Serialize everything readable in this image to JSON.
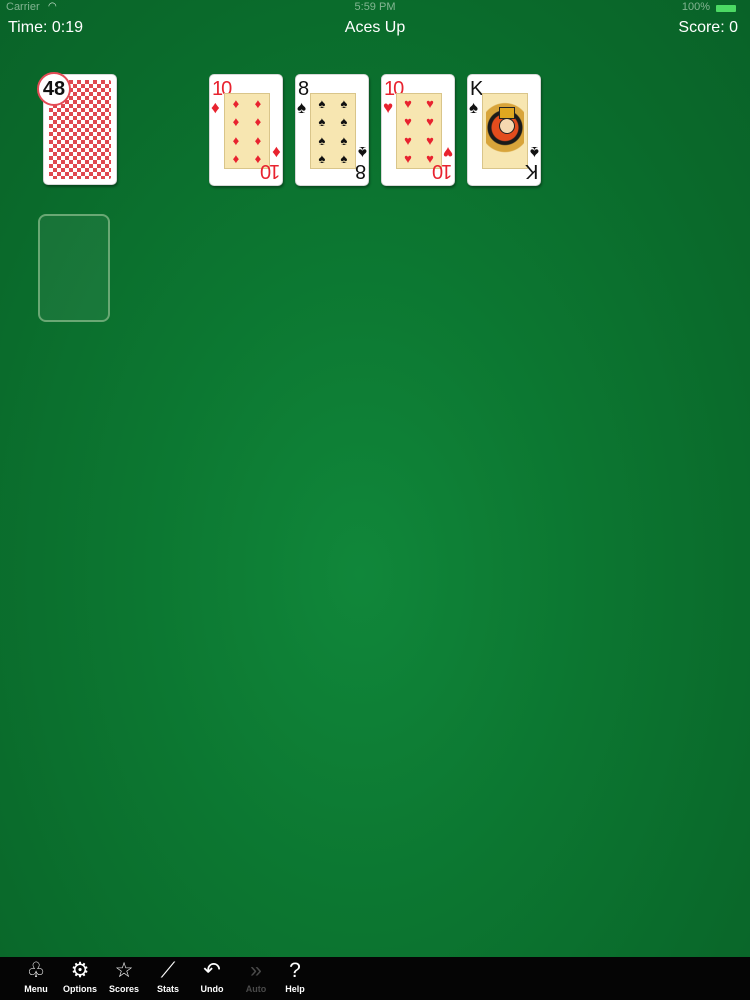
{
  "status_bar": {
    "carrier": "Carrier",
    "time": "5:59 PM",
    "battery": "100%"
  },
  "header": {
    "time": "Time: 0:19",
    "title": "Aces Up",
    "score": "Score: 0"
  },
  "stock": {
    "count": "48"
  },
  "tableau": [
    {
      "rank": "10",
      "suit": "♦",
      "color": "red",
      "name": "ten-of-diamonds"
    },
    {
      "rank": "8",
      "suit": "♠",
      "color": "black",
      "name": "eight-of-spades"
    },
    {
      "rank": "10",
      "suit": "♥",
      "color": "red",
      "name": "ten-of-hearts"
    },
    {
      "rank": "K",
      "suit": "♠",
      "color": "black",
      "name": "king-of-spades"
    }
  ],
  "toolbar": {
    "items": [
      {
        "label": "Menu",
        "icon": "card-suits-icon"
      },
      {
        "label": "Options",
        "icon": "gears-icon"
      },
      {
        "label": "Scores",
        "icon": "star-icon"
      },
      {
        "label": "Stats",
        "icon": "stats-chart-icon"
      },
      {
        "label": "Undo",
        "icon": "undo-icon"
      },
      {
        "label": "Auto",
        "icon": "fast-forward-icon",
        "disabled": true
      },
      {
        "label": "Help",
        "icon": "help-icon"
      }
    ]
  },
  "colors": {
    "felt": "#0c7731",
    "card_back": "#e0484f",
    "red_suit": "#e8232f"
  }
}
